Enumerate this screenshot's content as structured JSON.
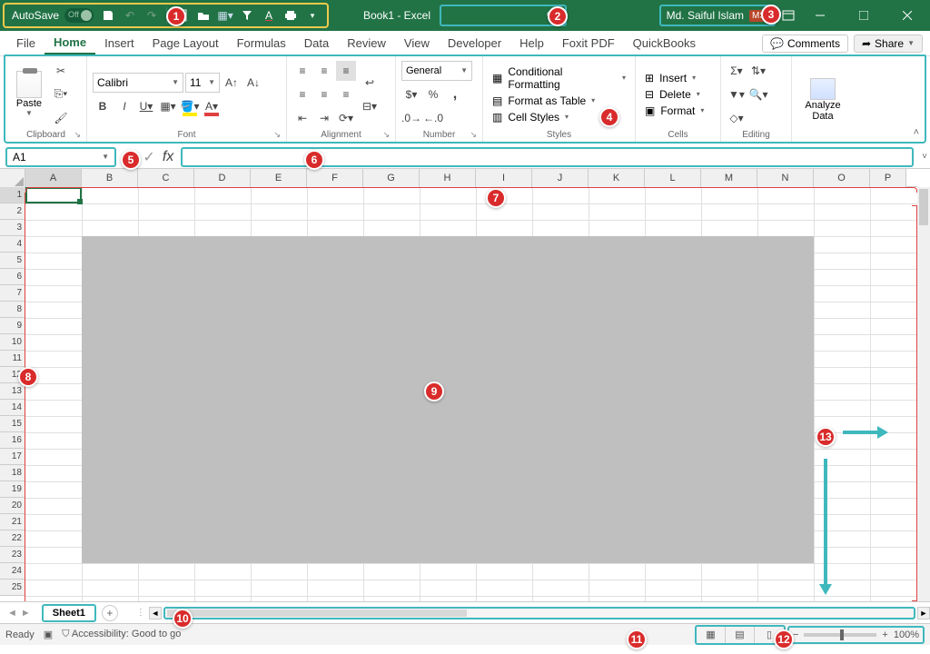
{
  "titlebar": {
    "autosave_label": "AutoSave",
    "autosave_state": "Off",
    "doc_title": "Book1  -  Excel",
    "user_name": "Md. Saiful Islam",
    "user_initials": "MS"
  },
  "tabs": {
    "file": "File",
    "home": "Home",
    "insert": "Insert",
    "page_layout": "Page Layout",
    "formulas": "Formulas",
    "data": "Data",
    "review": "Review",
    "view": "View",
    "developer": "Developer",
    "help": "Help",
    "foxit": "Foxit PDF",
    "quickbooks": "QuickBooks",
    "comments": "Comments",
    "share": "Share"
  },
  "ribbon": {
    "clipboard": {
      "paste": "Paste",
      "label": "Clipboard"
    },
    "font": {
      "name": "Calibri",
      "size": "11",
      "label": "Font"
    },
    "alignment": {
      "label": "Alignment"
    },
    "number": {
      "format": "General",
      "label": "Number"
    },
    "styles": {
      "cond": "Conditional Formatting",
      "table": "Format as Table",
      "cell": "Cell Styles",
      "label": "Styles"
    },
    "cells": {
      "insert": "Insert",
      "delete": "Delete",
      "format": "Format",
      "label": "Cells"
    },
    "editing": {
      "label": "Editing"
    },
    "analyze": {
      "line1": "Analyze",
      "line2": "Data"
    }
  },
  "namebox": {
    "value": "A1"
  },
  "columns": [
    "A",
    "B",
    "C",
    "D",
    "E",
    "F",
    "G",
    "H",
    "I",
    "J",
    "K",
    "L",
    "M",
    "N",
    "O",
    "P"
  ],
  "rows": [
    "1",
    "2",
    "3",
    "4",
    "5",
    "6",
    "7",
    "8",
    "9",
    "10",
    "11",
    "12",
    "13",
    "14",
    "15",
    "16",
    "17",
    "18",
    "19",
    "20",
    "21",
    "22",
    "23",
    "24",
    "25"
  ],
  "sheettab": {
    "name": "Sheet1"
  },
  "status": {
    "ready": "Ready",
    "access": "Accessibility: Good to go",
    "zoom": "100%"
  },
  "badges": {
    "b1": "1",
    "b2": "2",
    "b3": "3",
    "b4": "4",
    "b5": "5",
    "b6": "6",
    "b7": "7",
    "b8": "8",
    "b9": "9",
    "b10": "10",
    "b11": "11",
    "b12": "12",
    "b13": "13"
  }
}
